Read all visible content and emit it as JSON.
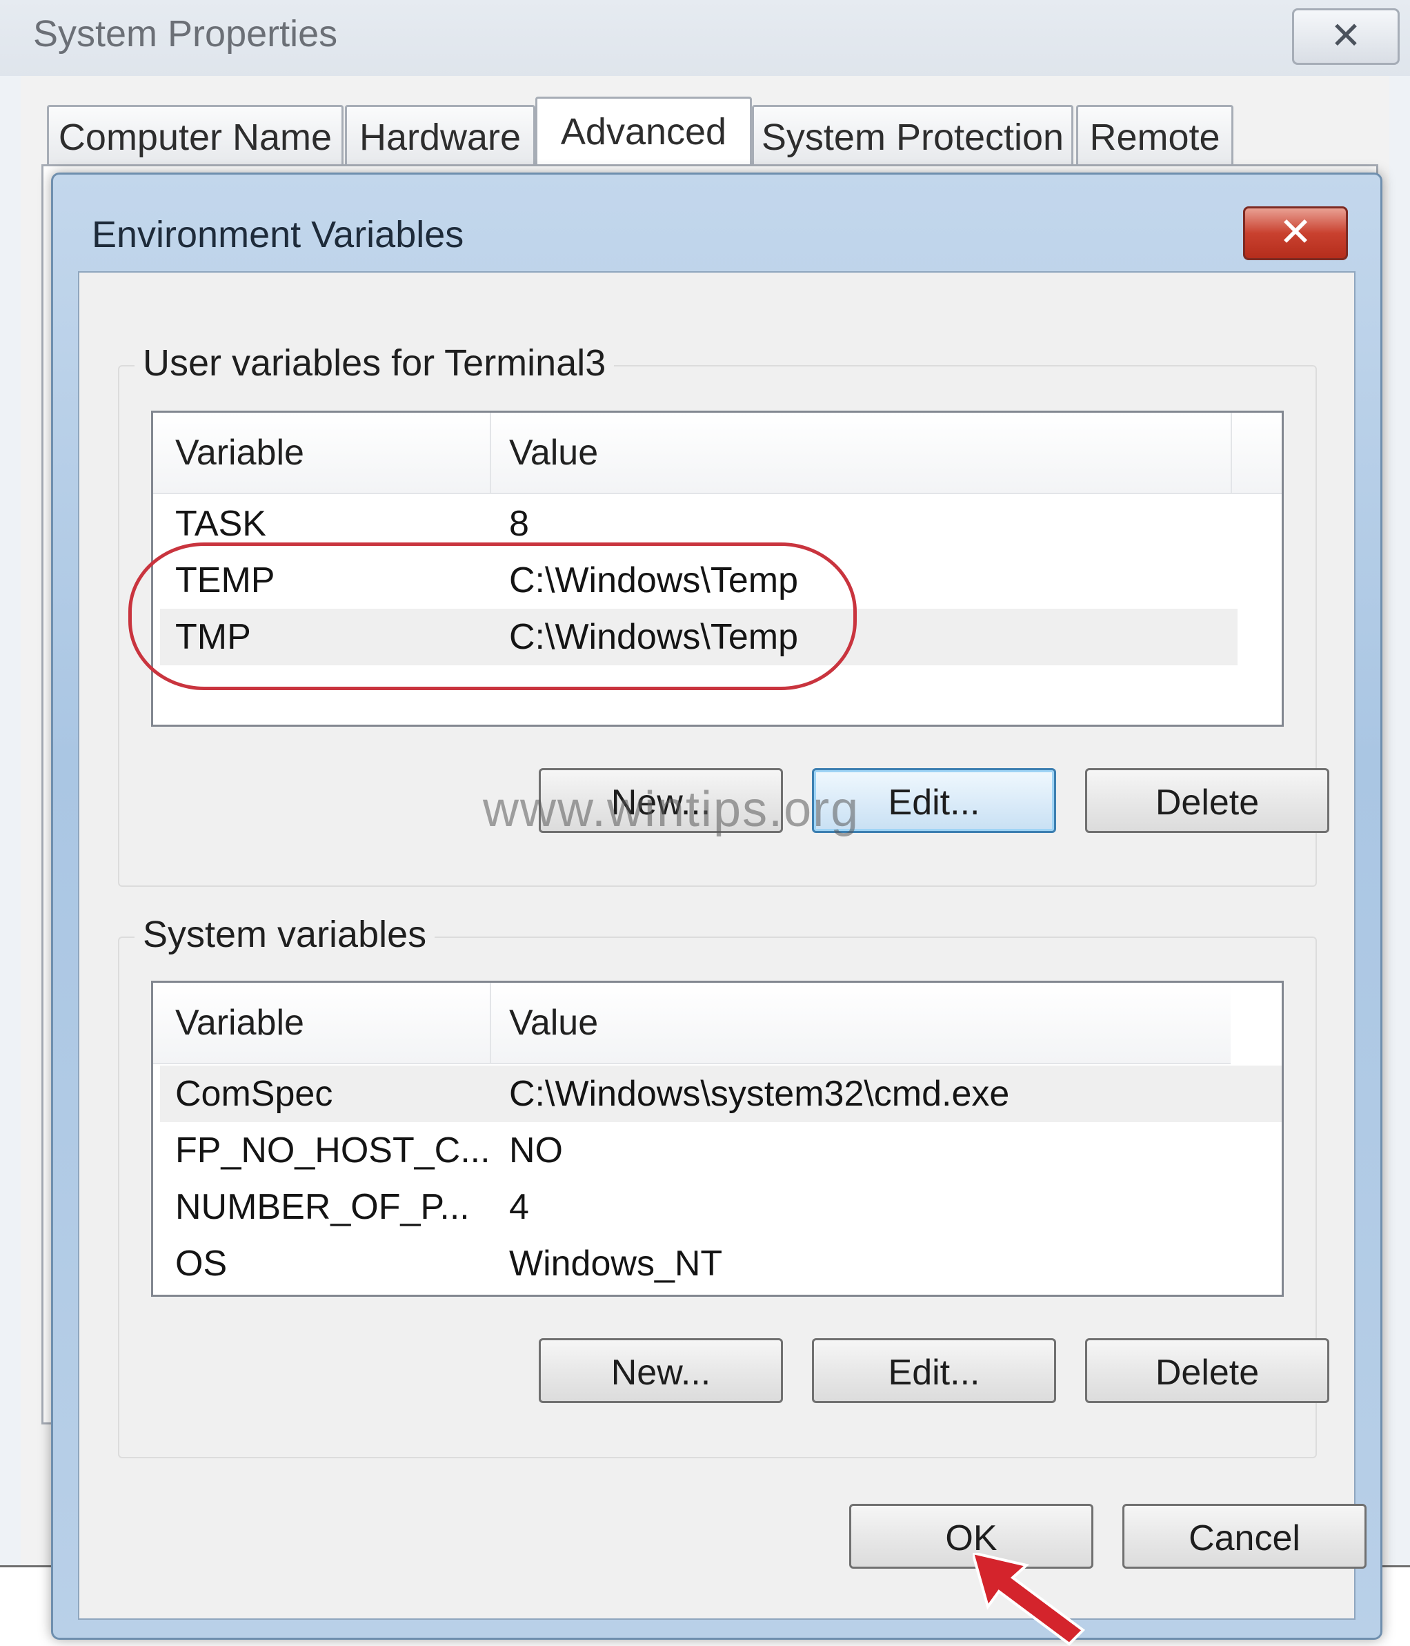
{
  "system_properties": {
    "title": "System Properties",
    "close_glyph": "✕",
    "tabs": [
      "Computer Name",
      "Hardware",
      "Advanced",
      "System Protection",
      "Remote"
    ],
    "active_tab": "Advanced"
  },
  "env_dialog": {
    "title": "Environment Variables",
    "close_glyph": "✕",
    "user_group": {
      "label": "User variables for Terminal3",
      "columns": [
        "Variable",
        "Value"
      ],
      "rows": [
        {
          "variable": "TASK",
          "value": "8"
        },
        {
          "variable": "TEMP",
          "value": "C:\\Windows\\Temp"
        },
        {
          "variable": "TMP",
          "value": "C:\\Windows\\Temp"
        }
      ],
      "buttons": {
        "new": "New...",
        "edit": "Edit...",
        "delete": "Delete"
      }
    },
    "system_group": {
      "label": "System variables",
      "columns": [
        "Variable",
        "Value"
      ],
      "rows": [
        {
          "variable": "ComSpec",
          "value": "C:\\Windows\\system32\\cmd.exe"
        },
        {
          "variable": "FP_NO_HOST_C...",
          "value": "NO"
        },
        {
          "variable": "NUMBER_OF_P...",
          "value": "4"
        },
        {
          "variable": "OS",
          "value": "Windows_NT"
        }
      ],
      "buttons": {
        "new": "New...",
        "edit": "Edit...",
        "delete": "Delete"
      }
    },
    "footer": {
      "ok": "OK",
      "cancel": "Cancel"
    }
  },
  "watermark": "www.wintips.org",
  "colors": {
    "annotation_red": "#c9343e",
    "dialog_frame": "#aac6e3",
    "close_red": "#c9412f"
  }
}
